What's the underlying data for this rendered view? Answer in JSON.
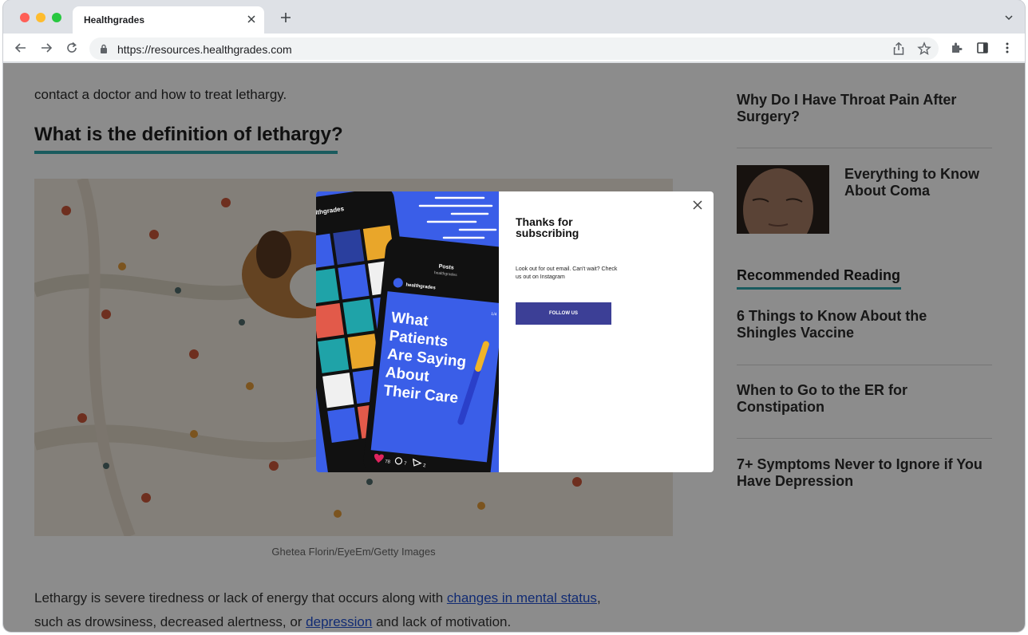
{
  "browser": {
    "tab_title": "Healthgrades",
    "url": "https://resources.healthgrades.com"
  },
  "article": {
    "intro_fragment": "contact a doctor and how to treat lethargy.",
    "heading": "What is the definition of lethargy?",
    "image_caption": "Ghetea Florin/EyeEm/Getty Images",
    "body_part1": "Lethargy is severe tiredness or lack of energy that occurs along with ",
    "link1": "changes in mental status",
    "body_part2": ",",
    "body_part3": "such as drowsiness, decreased alertness, or ",
    "link2": "depression",
    "body_part4": " and lack of motivation."
  },
  "sidebar": {
    "top_link": "Why Do I Have Throat Pain After Surgery?",
    "featured_link": "Everything to Know About Coma",
    "recommended_heading": "Recommended Reading",
    "recommended": [
      "6 Things to Know About the Shingles Vaccine",
      "When to Go to the ER for Constipation",
      "7+ Symptoms Never to Ignore if You Have Depression"
    ]
  },
  "modal": {
    "title": "Thanks for subscribing",
    "description": "Look out for out email. Can't wait? Check us out on Instagram",
    "button_label": "FOLLOW US",
    "art": {
      "brand": "healthgrades",
      "posts_label": "Posts",
      "posts_sub": "healthgrades",
      "poster_line1": "What",
      "poster_line2": "Patients",
      "poster_line3": "Are Saying",
      "poster_line4": "About",
      "poster_line5": "Their Care",
      "counter": "1/4",
      "likes": "78",
      "comments": "7",
      "shares": "2"
    }
  },
  "colors": {
    "accent_teal": "#31a6ac",
    "modal_art_blue": "#3a5ee8",
    "button_navy": "#3c3f96",
    "link_blue": "#1f4fd1"
  }
}
